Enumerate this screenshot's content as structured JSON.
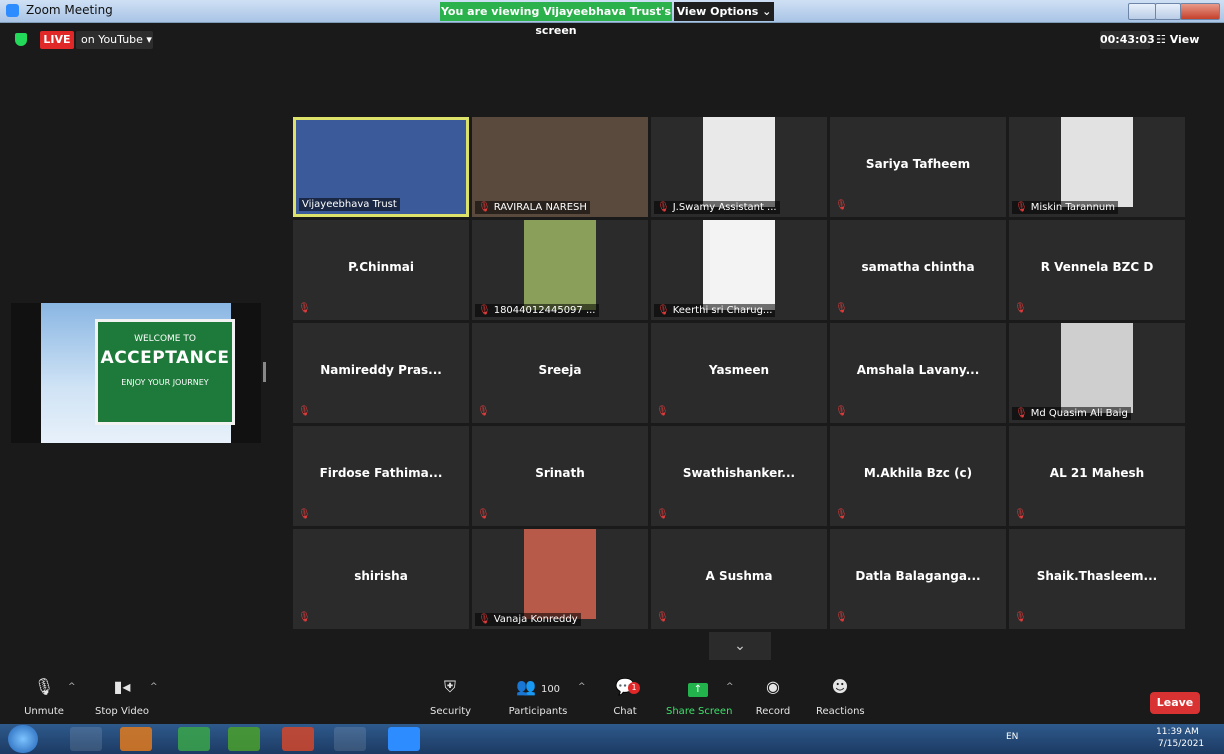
{
  "window": {
    "title": "Zoom Meeting"
  },
  "banner": {
    "viewing": "You are viewing Vijayeebhava Trust's screen",
    "view_options": "View Options ⌄"
  },
  "topbar": {
    "live": "LIVE",
    "on_youtube": "on YouTube ▾",
    "timer": "00:43:03",
    "view": "☷ View"
  },
  "shared_screen": {
    "line1": "WELCOME TO",
    "line2": "ACCEPTANCE",
    "line3": "ENJOY YOUR JOURNEY"
  },
  "participants": [
    {
      "name": "Vijayeebhava Trust",
      "video": true,
      "active": true
    },
    {
      "name": "RAVIRALA NARESH",
      "video": true
    },
    {
      "name": "J.Swamy Assistant ...",
      "video": true
    },
    {
      "name": "Sariya Tafheem",
      "video": false
    },
    {
      "name": "Miskin Tarannum",
      "video": true
    },
    {
      "name": "P.Chinmai",
      "video": false
    },
    {
      "name": "18044012445097 ...",
      "video": true
    },
    {
      "name": "Keerthi sri Charug...",
      "video": true
    },
    {
      "name": "samatha chintha",
      "video": false
    },
    {
      "name": "R Vennela BZC D",
      "video": false
    },
    {
      "name": "Namireddy Pras...",
      "video": false
    },
    {
      "name": "Sreeja",
      "video": false
    },
    {
      "name": "Yasmeen",
      "video": false
    },
    {
      "name": "Amshala Lavany...",
      "video": false
    },
    {
      "name": "Md Quasim Ali Baig",
      "video": true
    },
    {
      "name": "Firdose Fathima...",
      "video": false
    },
    {
      "name": "Srinath",
      "video": false
    },
    {
      "name": "Swathishanker...",
      "video": false
    },
    {
      "name": "M.Akhila Bzc (c)",
      "video": false
    },
    {
      "name": "AL 21 Mahesh",
      "video": false
    },
    {
      "name": "shirisha",
      "video": false
    },
    {
      "name": "Vanaja Konreddy",
      "video": true
    },
    {
      "name": "A Sushma",
      "video": false
    },
    {
      "name": "Datla Balaganga...",
      "video": false
    },
    {
      "name": "Shaik.Thasleem...",
      "video": false
    }
  ],
  "toolbar": {
    "unmute": "Unmute",
    "stop_video": "Stop Video",
    "security": "Security",
    "participants": "Participants",
    "participants_count": "100",
    "chat": "Chat",
    "chat_badge": "1",
    "share_screen": "Share Screen",
    "record": "Record",
    "reactions": "Reactions",
    "leave": "Leave"
  },
  "taskbar": {
    "lang": "EN",
    "time": "11:39 AM",
    "date": "7/15/2021"
  },
  "colors": {
    "accent_green": "#2bb24c",
    "live_red": "#e02828",
    "active_border": "#dde36a",
    "leave_red": "#d93232"
  }
}
